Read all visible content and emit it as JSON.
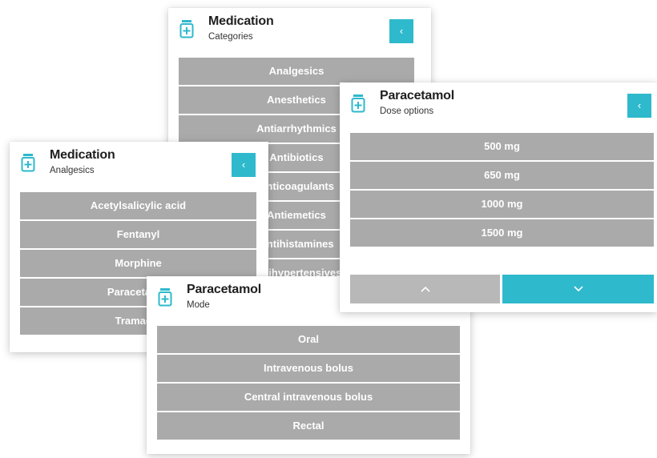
{
  "colors": {
    "accent": "#2eb9cc",
    "item_bg": "#aaaaaa"
  },
  "icons": {
    "header": "medicine-bottle-icon",
    "back": "chevron-left-icon",
    "page_up": "chevron-up-icon",
    "page_down": "chevron-down-icon"
  },
  "categories": {
    "title": "Medication",
    "subtitle": "Categories",
    "back_label": "‹",
    "items": [
      "Analgesics",
      "Anesthetics",
      "Antiarrhythmics",
      "Antibiotics",
      "Anticoagulants",
      "Antiemetics",
      "Antihistamines",
      "Antihypertensives"
    ]
  },
  "analgesics": {
    "title": "Medication",
    "subtitle": "Analgesics",
    "back_label": "‹",
    "items": [
      "Acetylsalicylic acid",
      "Fentanyl",
      "Morphine",
      "Paracetamol",
      "Tramadol"
    ]
  },
  "mode": {
    "title": "Paracetamol",
    "subtitle": "Mode",
    "items": [
      "Oral",
      "Intravenous bolus",
      "Central intravenous bolus",
      "Rectal"
    ]
  },
  "dose": {
    "title": "Paracetamol",
    "subtitle": "Dose options",
    "back_label": "‹",
    "items": [
      "500 mg",
      "650 mg",
      "1000 mg",
      "1500 mg"
    ]
  }
}
